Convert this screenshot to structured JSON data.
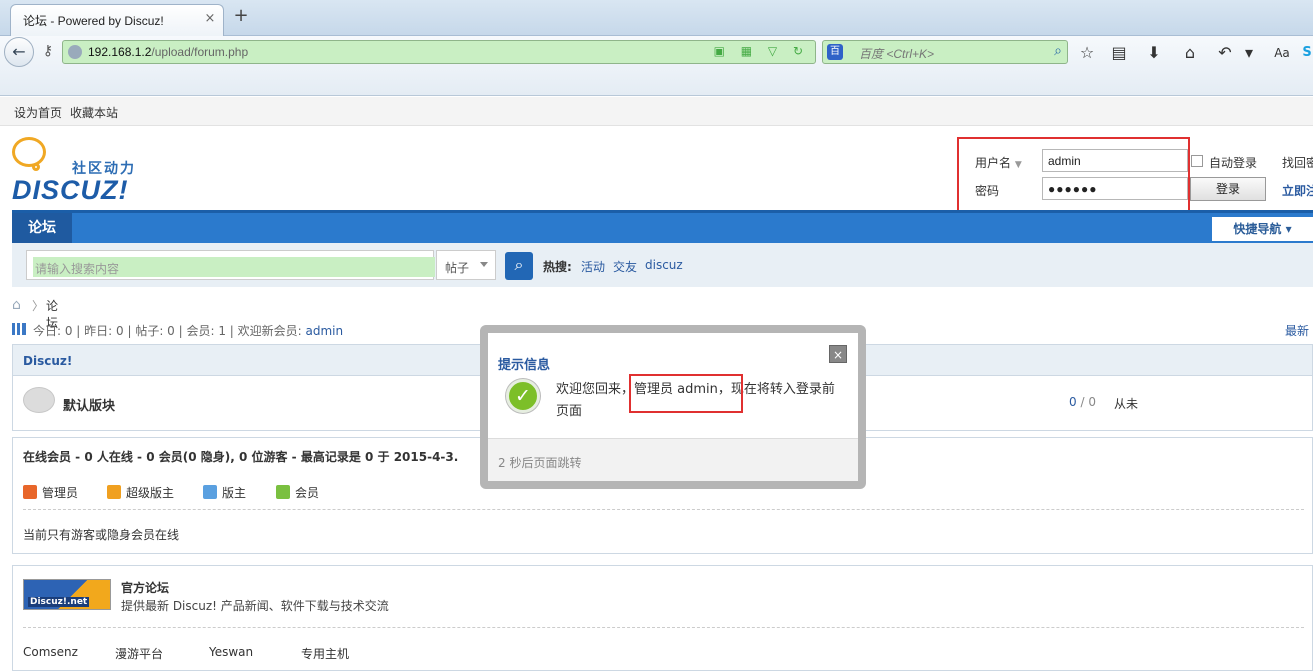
{
  "browser": {
    "tab_title": "论坛 - Powered by Discuz!",
    "tab_close": "×",
    "new_tab": "+",
    "url_host": "192.168.1.2",
    "url_path": "/upload/forum.php",
    "url_icons": "▣ ▦ ▽ ↻",
    "search_placeholder": "百度 <Ctrl+K>",
    "toolbar_icons": [
      "star-icon",
      "bookmarks-icon",
      "download-icon",
      "home-icon",
      "back-arrow-icon",
      "menu-icon",
      "reader-icon",
      "skype-icon"
    ],
    "toolbar_glyphs": [
      "☆",
      "▤",
      "⬇",
      "⌂",
      "↶",
      "▾",
      "Aa",
      "S"
    ]
  },
  "top_links": [
    "设为首页",
    "收藏本站"
  ],
  "logo": {
    "sub": "社区动力",
    "main": "DISCUZ!"
  },
  "login": {
    "username_label": "用户名",
    "username_value": "admin",
    "password_label": "密码",
    "password_value": "●●●●●●",
    "auto_login": "自动登录",
    "login_button": "登录",
    "find_password": "找回密",
    "register": "立即注"
  },
  "nav": {
    "active": "论坛",
    "quick_nav": "快捷导航 ▾"
  },
  "search": {
    "placeholder": "请输入搜索内容",
    "type": "帖子",
    "hot_label": "热搜:",
    "hot_links": [
      "活动",
      "交友",
      "discuz"
    ]
  },
  "breadcrumb": {
    "sep": "〉",
    "current": "论坛"
  },
  "stats": {
    "text": "今日: 0 | 昨日: 0 | 帖子: 0 | 会员: 1 | 欢迎新会员: ",
    "new_member": "admin",
    "newest": "最新"
  },
  "category": {
    "title": "Discuz!",
    "forum_name": "默认版块",
    "count_a": "0",
    "count_b": " / 0",
    "last_post": "从未"
  },
  "online": {
    "title": "在线会员 - 0 人在线 - 0 会员(0 隐身), 0 位游客 - 最高记录是 0 于 2015-4-3.",
    "legend": [
      "管理员",
      "超级版主",
      "版主",
      "会员"
    ],
    "legend_colors": [
      "#e8662a",
      "#f0a020",
      "#5aa0e0",
      "#7ac040"
    ],
    "note": "当前只有游客或隐身会员在线"
  },
  "links": {
    "logo_text": "Discuz!.net",
    "title": "官方论坛",
    "desc": "提供最新 Discuz! 产品新闻、软件下载与技术交流",
    "items": [
      "Comsenz",
      "漫游平台",
      "Yeswan",
      "专用主机"
    ]
  },
  "modal": {
    "title": "提示信息",
    "close": "×",
    "message": "欢迎您回来，管理员 admin，现在将转入登录前页面",
    "footer": "2 秒后页面跳转"
  }
}
